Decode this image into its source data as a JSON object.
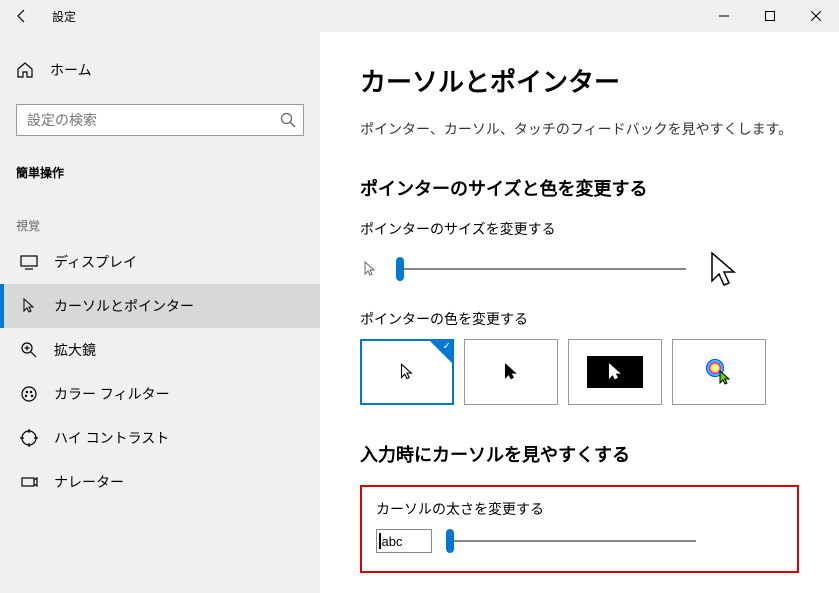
{
  "titlebar": {
    "title": "設定"
  },
  "sidebar": {
    "home": "ホーム",
    "searchPlaceholder": "設定の検索",
    "category": "簡単操作",
    "group": "視覚",
    "items": [
      {
        "label": "ディスプレイ",
        "icon": "display-icon"
      },
      {
        "label": "カーソルとポインター",
        "icon": "cursor-icon",
        "selected": true
      },
      {
        "label": "拡大鏡",
        "icon": "magnifier-icon"
      },
      {
        "label": "カラー フィルター",
        "icon": "color-filter-icon"
      },
      {
        "label": "ハイ コントラスト",
        "icon": "contrast-icon"
      },
      {
        "label": "ナレーター",
        "icon": "narrator-icon"
      }
    ]
  },
  "content": {
    "title": "カーソルとポインター",
    "description": "ポインター、カーソル、タッチのフィードバックを見やすくします。",
    "section1": {
      "heading": "ポインターのサイズと色を変更する",
      "sizeLabel": "ポインターのサイズを変更する",
      "colorLabel": "ポインターの色を変更する"
    },
    "section2": {
      "heading": "入力時にカーソルを見やすくする",
      "thicknessLabel": "カーソルの太さを変更する",
      "sample": "abc"
    },
    "pointerColorOptions": [
      {
        "type": "white",
        "selected": true
      },
      {
        "type": "black"
      },
      {
        "type": "inverted"
      },
      {
        "type": "custom"
      }
    ]
  }
}
